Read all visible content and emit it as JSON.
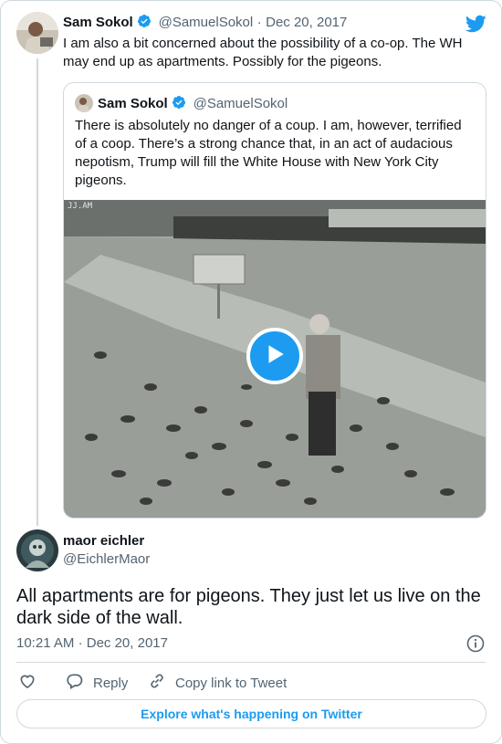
{
  "parent_tweet": {
    "author_name": "Sam Sokol",
    "author_handle": "@SamuelSokol",
    "separator": "·",
    "date": "Dec 20, 2017",
    "text": "I am also a bit concerned about the possibility of a co-op. The WH may end up as apartments. Possibly for the pigeons."
  },
  "quoted_tweet": {
    "author_name": "Sam Sokol",
    "author_handle": "@SamuelSokol",
    "text": "There is absolutely no danger of a coup. I am, however, terrified of a coop. There’s a strong chance that, in an act of audacious nepotism, Trump will fill the White House with New York City pigeons.",
    "media_watermark": "JJ.AM"
  },
  "main_tweet": {
    "author_name": "maor eichler",
    "author_handle": "@EichlerMaor",
    "text": "All apartments are for pigeons. They just let us live on the dark side of the wall.",
    "time": "10:21 AM",
    "separator": "·",
    "date": "Dec 20, 2017"
  },
  "actions": {
    "reply_label": "Reply",
    "copy_link_label": "Copy link to Tweet"
  },
  "footer": {
    "explore_label": "Explore what's happening on Twitter"
  },
  "icons": {
    "brand": "twitter-bird-icon",
    "verified": "verified-badge-icon",
    "info": "info-icon",
    "like": "heart-icon",
    "reply": "reply-bubble-icon",
    "copy_link": "link-icon",
    "play": "play-icon"
  },
  "colors": {
    "accent": "#1d9bf0",
    "text": "#0f1419",
    "secondary": "#536471",
    "border": "#cfd9de"
  }
}
